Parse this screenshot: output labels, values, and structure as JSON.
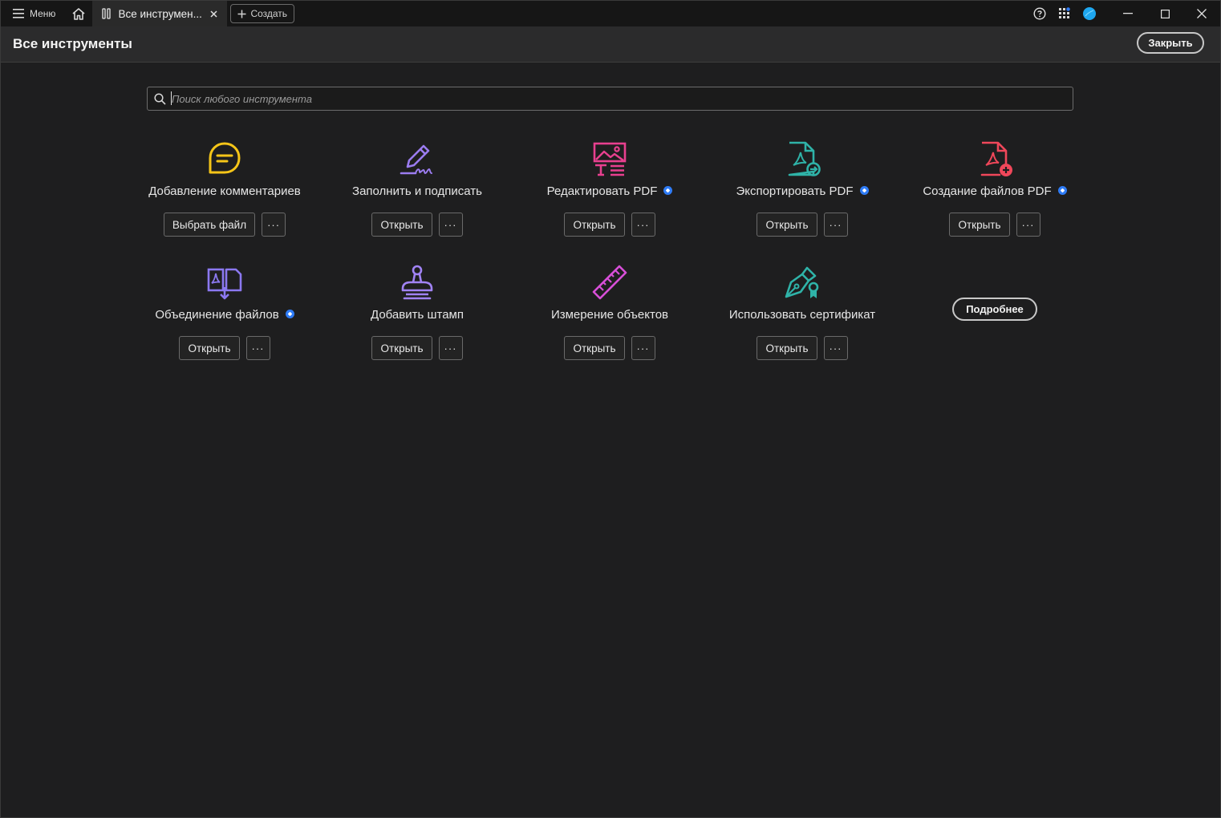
{
  "titlebar": {
    "menu_label": "Меню",
    "tab_label": "Все инструмен...",
    "create_label": "Создать"
  },
  "header": {
    "title": "Все инструменты",
    "close_label": "Закрыть"
  },
  "search": {
    "placeholder": "Поиск любого инструмента",
    "value": ""
  },
  "tools": [
    {
      "name": "Добавление комментариев",
      "icon": "comment-icon",
      "color": "#f5c518",
      "premium": false,
      "button": "Выбрать файл"
    },
    {
      "name": "Заполнить и подписать",
      "icon": "fill-sign-icon",
      "color": "#9b7cf0",
      "premium": false,
      "button": "Открыть"
    },
    {
      "name": "Редактировать PDF",
      "icon": "edit-pdf-icon",
      "color": "#e8408f",
      "premium": true,
      "button": "Открыть"
    },
    {
      "name": "Экспортировать PDF",
      "icon": "export-pdf-icon",
      "color": "#2fb3a8",
      "premium": true,
      "button": "Открыть"
    },
    {
      "name": "Создание файлов PDF",
      "icon": "create-pdf-icon",
      "color": "#f0475a",
      "premium": true,
      "button": "Открыть"
    },
    {
      "name": "Объединение файлов",
      "icon": "combine-files-icon",
      "color": "#8b78f0",
      "premium": true,
      "button": "Открыть"
    },
    {
      "name": "Добавить штамп",
      "icon": "stamp-icon",
      "color": "#a183f5",
      "premium": false,
      "button": "Открыть"
    },
    {
      "name": "Измерение объектов",
      "icon": "ruler-icon",
      "color": "#d84fd8",
      "premium": false,
      "button": "Открыть"
    },
    {
      "name": "Использовать сертификат",
      "icon": "certificate-icon",
      "color": "#2fb3a8",
      "premium": false,
      "button": "Открыть"
    }
  ],
  "more_label": "Подробнее",
  "more_actions_label": "···",
  "colors": {
    "premium_badge": "#2f7cf6",
    "avatar": "#1ea7f0",
    "background": "#1e1e1f"
  }
}
